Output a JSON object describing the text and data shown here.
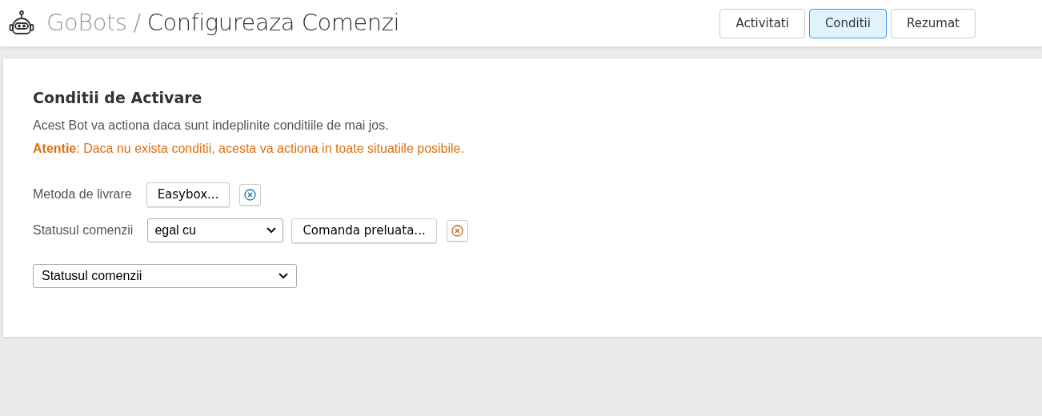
{
  "header": {
    "brand": "GoBots",
    "separator": "/",
    "title": "Configureaza Comenzi"
  },
  "steps": [
    {
      "label": "Activitati",
      "selected": false
    },
    {
      "label": "Conditii",
      "selected": true
    },
    {
      "label": "Rezumat",
      "selected": false
    }
  ],
  "panel": {
    "heading": "Conditii de Activare",
    "description": "Acest Bot va actiona daca sunt indeplinite conditiile de mai jos.",
    "warning": "**Atentie**: Daca nu exista conditii, acesta va actiona in toate situatiile posibile."
  },
  "conditions": [
    {
      "kind": "simple",
      "label": "Metoda de livrare",
      "value": "Easybox...",
      "color": "#1a6fb0"
    },
    {
      "kind": "operator",
      "label": "Statusul comenzii",
      "operator": "egal cu",
      "value": "Comanda preluata...",
      "color": "#b8691a"
    }
  ],
  "add_condition": {
    "value": "Statusul comenzii"
  }
}
